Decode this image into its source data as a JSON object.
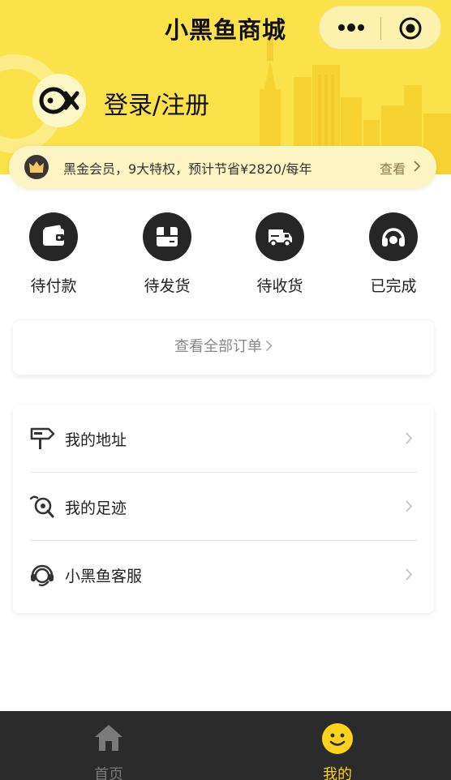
{
  "header": {
    "title": "小黑鱼商城",
    "login_text": "登录/注册",
    "capsule_icons": [
      "more-dots-icon",
      "target-circle-icon"
    ]
  },
  "vip": {
    "text": "黑金会员，9大特权，预计节省¥2820/每年",
    "view_label": "查看",
    "icon": "crown-icon"
  },
  "orders": {
    "items": [
      {
        "label": "待付款",
        "icon": "wallet-icon"
      },
      {
        "label": "待发货",
        "icon": "package-icon"
      },
      {
        "label": "待收货",
        "icon": "delivery-truck-icon"
      },
      {
        "label": "已完成",
        "icon": "headset-icon"
      }
    ],
    "all_label": "查看全部订单"
  },
  "menu": {
    "items": [
      {
        "label": "我的地址",
        "icon": "signpost-icon"
      },
      {
        "label": "我的足迹",
        "icon": "footprint-icon"
      },
      {
        "label": "小黑鱼客服",
        "icon": "support-headset-icon"
      }
    ]
  },
  "tabbar": {
    "items": [
      {
        "label": "首页",
        "icon": "home-icon",
        "active": false
      },
      {
        "label": "我的",
        "icon": "smiley-icon",
        "active": true
      }
    ],
    "active_color": "#fcd21b",
    "inactive_color": "#7a7a7a"
  },
  "colors": {
    "brand_yellow": "#fbe24a",
    "vip_bg": "#fdf4c4",
    "dark": "#262626"
  }
}
